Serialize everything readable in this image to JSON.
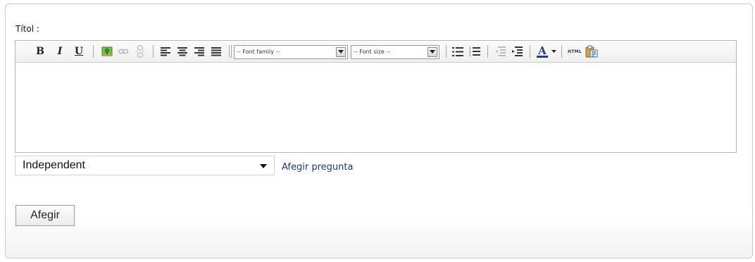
{
  "form": {
    "title_label": "Títol :",
    "question_type": "Independent",
    "add_question_link": "Afegir pregunta",
    "submit_label": "Afegir"
  },
  "toolbar": {
    "bold": "B",
    "italic": "I",
    "underline": "U",
    "font_family_placeholder": "-- Font family --",
    "font_size_placeholder": "-- Font size --",
    "html_label": "HTML",
    "text_color_letter": "A"
  },
  "colors": {
    "link": "#1a3d6e",
    "text_color_bar": "#1f3f86",
    "border": "#c9c9c9"
  }
}
